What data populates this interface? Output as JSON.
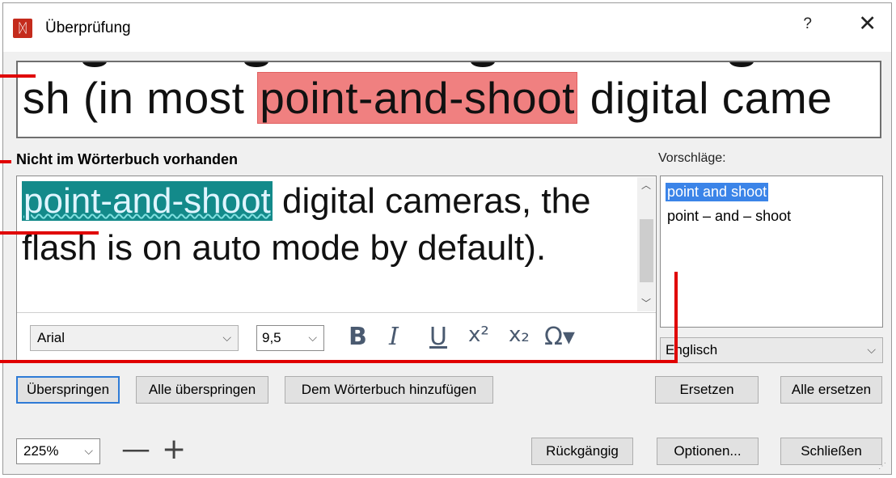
{
  "window": {
    "title": "Überprüfung",
    "help": "?",
    "close": "✕"
  },
  "preview": {
    "before": "sh (in most ",
    "highlight": "point-and-shoot",
    "after": " digital came"
  },
  "section": {
    "not_in_dictionary": "Nicht im Wörterbuch vorhanden",
    "suggestions_label": "Vorschläge:"
  },
  "editor": {
    "error_word": "point-and-shoot",
    "rest": " digital cameras, the flash is on auto mode by default)."
  },
  "format": {
    "font": "Arial",
    "size": "9,5",
    "bold": "B",
    "italic": "I",
    "underline": "U",
    "superscript": "x²",
    "subscript": "x₂",
    "symbol": "Ω▾"
  },
  "suggestions": [
    "point and shoot",
    "point – and – shoot"
  ],
  "language": "Englisch",
  "buttons": {
    "skip": "Überspringen",
    "skip_all": "Alle überspringen",
    "add_dictionary": "Dem Wörterbuch hinzufügen",
    "replace": "Ersetzen",
    "replace_all": "Alle ersetzen",
    "undo": "Rückgängig",
    "options": "Optionen...",
    "close": "Schließen"
  },
  "zoom": {
    "value": "225%",
    "minus": "—",
    "plus": "+"
  },
  "colors": {
    "highlight": "#f08080",
    "error_bg": "#138a8a",
    "selection": "#3b84e8",
    "callout": "#e00000"
  }
}
